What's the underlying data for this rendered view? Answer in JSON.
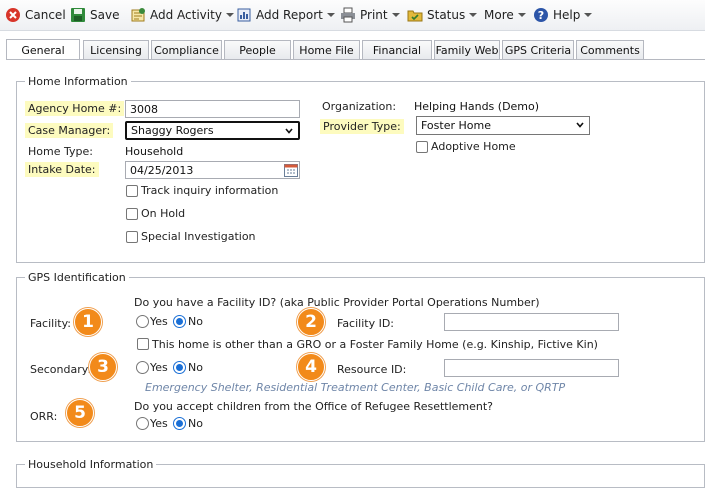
{
  "toolbar": {
    "cancel": "Cancel",
    "save": "Save",
    "add_activity": "Add Activity",
    "add_report": "Add Report",
    "print": "Print",
    "status": "Status",
    "more": "More",
    "help": "Help"
  },
  "tabs": [
    "General",
    "Licensing",
    "Compliance",
    "People",
    "Home File",
    "Financial",
    "Family Web",
    "GPS Criteria",
    "Comments"
  ],
  "home_info": {
    "legend": "Home Information",
    "agency_home_label": "Agency Home #:",
    "agency_home_value": "3008",
    "case_manager_label": "Case Manager:",
    "case_manager_value": "Shaggy Rogers",
    "home_type_label": "Home Type:",
    "home_type_value": "Household",
    "intake_date_label": "Intake Date:",
    "intake_date_value": "04/25/2013",
    "track_inquiry": "Track inquiry information",
    "on_hold": "On Hold",
    "special_investigation": "Special Investigation",
    "organization_label": "Organization:",
    "organization_value": "Helping Hands (Demo)",
    "provider_type_label": "Provider Type:",
    "provider_type_value": "Foster Home",
    "adoptive_home": "Adoptive Home"
  },
  "gps": {
    "legend": "GPS Identification",
    "facility_question": "Do you have a Facility ID? (aka Public Provider Portal Operations Number)",
    "facility_label": "Facility:",
    "yes": "Yes",
    "no": "No",
    "facility_id_label": "Facility ID:",
    "other_home": "This home is other than a GRO or a Foster Family Home (e.g. Kinship, Fictive Kin)",
    "secondary_label": "Secondary:",
    "resource_id_label": "Resource ID:",
    "secondary_hint": "Emergency Shelter, Residential Treatment Center, Basic Child Care, or QRTP",
    "orr_question": "Do you accept children from the Office of Refugee Resettlement?",
    "orr_label": "ORR:",
    "badges": [
      "1",
      "2",
      "3",
      "4",
      "5"
    ]
  },
  "household": {
    "legend": "Household Information"
  }
}
